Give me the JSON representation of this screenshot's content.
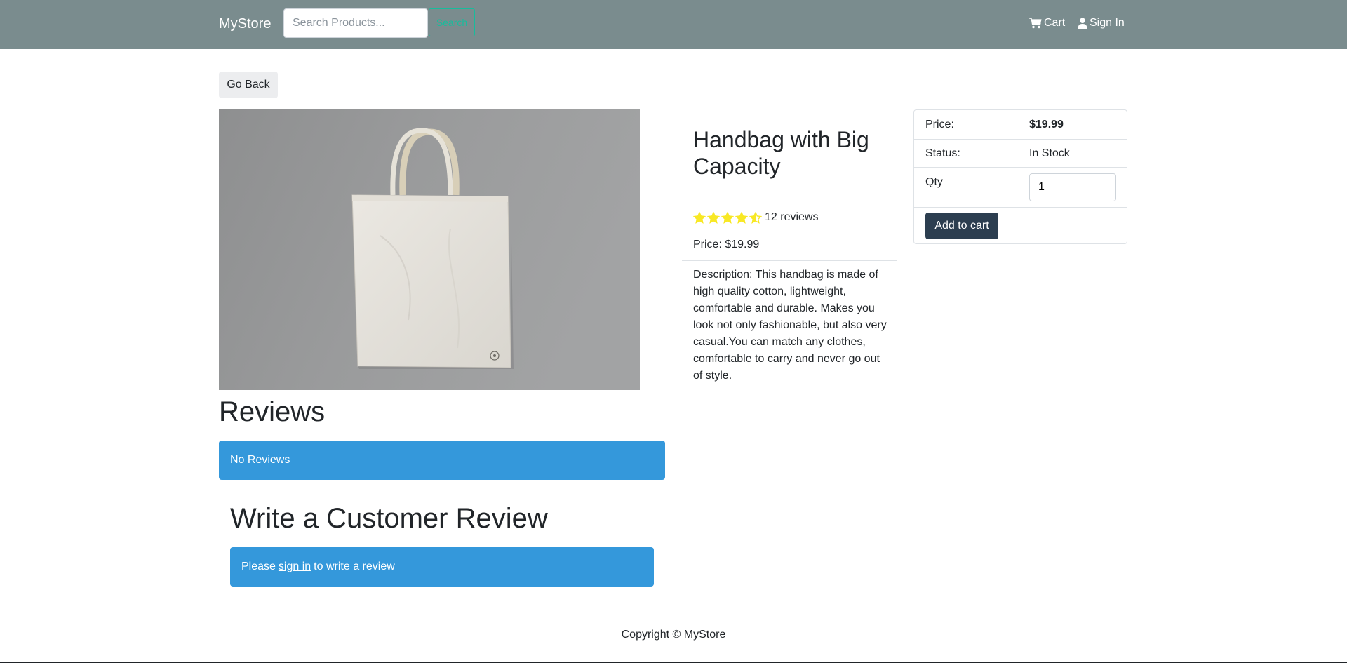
{
  "navbar": {
    "brand": "MyStore",
    "search_placeholder": "Search Products...",
    "search_button": "Search",
    "cart_label": "Cart",
    "signin_label": "Sign In",
    "background_color": "#7a8c8e",
    "search_button_color": "#18bc9c"
  },
  "go_back_label": "Go Back",
  "product": {
    "name": "Handbag with Big Capacity",
    "rating": 4.5,
    "rating_max": 5,
    "reviews_text": "12 reviews",
    "price_text": "Price: $19.99",
    "description": "Description: This handbag is made of high quality cotton, lightweight, comfortable and durable. Makes you look not only fashionable, but also very casual.You can match any clothes, comfortable to carry and never go out of style.",
    "star_color": "#f8e825"
  },
  "purchase": {
    "price_label": "Price:",
    "price_value": "$19.99",
    "status_label": "Status:",
    "status_value": "In Stock",
    "qty_label": "Qty",
    "qty_value": "1",
    "add_to_cart": "Add to cart",
    "button_color": "#2c3e50"
  },
  "reviews": {
    "heading": "Reviews",
    "empty_message": "No Reviews",
    "write_heading": "Write a Customer Review",
    "signin_prefix": "Please",
    "signin_link": "sign in",
    "signin_suffix": "to write a review",
    "alert_color": "#3498db"
  },
  "footer": {
    "copyright": "Copyright © MyStore"
  }
}
